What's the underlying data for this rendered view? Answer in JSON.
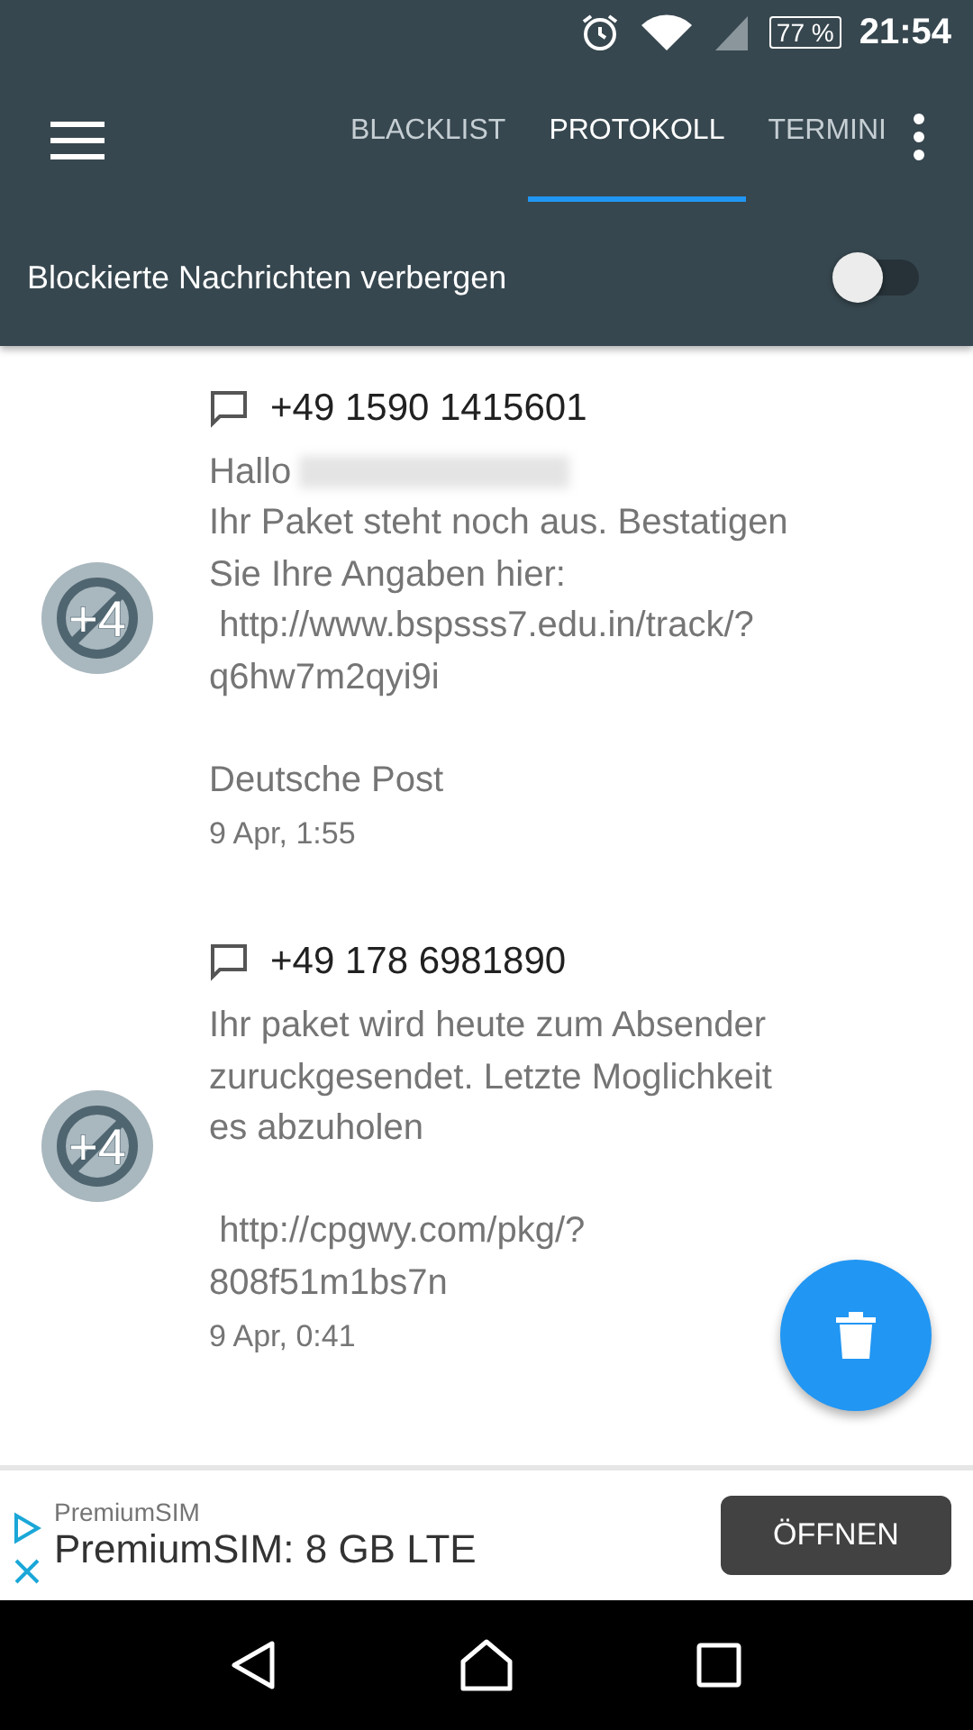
{
  "status_bar": {
    "battery": "77 %",
    "time": "21:54"
  },
  "tabs": [
    {
      "label": "BLACKLIST",
      "selected": false
    },
    {
      "label": "PROTOKOLL",
      "selected": true
    },
    {
      "label": "TERMINI",
      "selected": false
    }
  ],
  "toggle": {
    "label": "Blockierte Nachrichten verbergen",
    "on": false
  },
  "messages": [
    {
      "number": "+49 1590 1415601",
      "avatar_label": "+4",
      "greeting": "Hallo",
      "redacted": true,
      "body": "Ihr Paket steht noch aus. Bestatigen\nSie Ihre Angaben hier:\n http://www.bspsss7.edu.in/track/?\nq6hw7m2qyi9i\n\nDeutsche Post",
      "date": "9 Apr, 1:55"
    },
    {
      "number": "+49 178 6981890",
      "avatar_label": "+4",
      "body": "Ihr paket wird heute zum Absender\nzuruckgesendet. Letzte Moglichkeit\nes abzuholen\n\n http://cpgwy.com/pkg/?\n808f51m1bs7n",
      "date": "9 Apr, 0:41"
    }
  ],
  "ad": {
    "advertiser": "PremiumSIM",
    "headline": "PremiumSIM: 8 GB LTE",
    "button": "ÖFFNEN"
  }
}
